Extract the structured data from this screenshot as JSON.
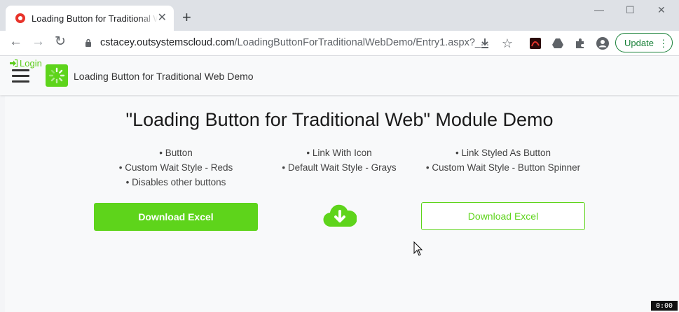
{
  "browser": {
    "tab_title": "Loading Button for Traditional Web Demo",
    "url_host": "cstacey.outsystemscloud.com",
    "url_path": "/LoadingButtonForTraditionalWebDemo/Entry1.aspx?_...",
    "update_label": "Update",
    "icons": [
      "back-icon",
      "forward-icon",
      "reload-icon",
      "lock-icon",
      "download-icon",
      "star-icon",
      "pdf-extension-icon",
      "drive-extension-icon",
      "extensions-icon",
      "profile-icon",
      "menu-icon"
    ]
  },
  "app": {
    "login_label": "Login",
    "title": "Loading Button for Traditional Web Demo"
  },
  "main": {
    "heading": "\"Loading Button for Traditional Web\" Module Demo",
    "columns": [
      {
        "lines": [
          "• Button",
          "• Custom Wait Style - Reds",
          "• Disables other buttons"
        ]
      },
      {
        "lines": [
          "• Link With Icon",
          "• Default Wait Style - Grays"
        ]
      },
      {
        "lines": [
          "• Link Styled As Button",
          "• Custom Wait Style - Button Spinner"
        ]
      }
    ],
    "button_solid_label": "Download Excel",
    "button_outline_label": "Download Excel"
  },
  "overlay": {
    "clock": "0:00"
  },
  "colors": {
    "accent": "#5ed41b",
    "chrome_bg": "#dee1e6",
    "update_green": "#188038"
  }
}
